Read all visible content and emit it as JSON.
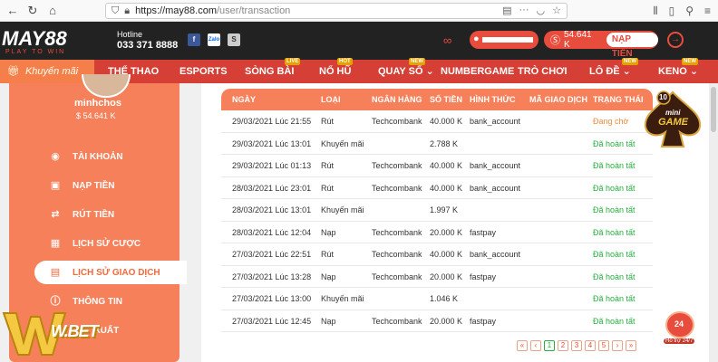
{
  "browser": {
    "url_host": "https://may88.com",
    "url_path": "/user/transaction"
  },
  "header": {
    "logo": "MAY88",
    "logo_sub": "PLAY TO WIN",
    "hotline_label": "Hotline",
    "hotline_number": "033 371 8888",
    "balance": "54.641 K",
    "deposit_label": "NẠP TIỀN"
  },
  "nav": {
    "items": [
      {
        "label": "Khuyến mãi"
      },
      {
        "label": "THỂ THAO"
      },
      {
        "label": "ESPORTS"
      },
      {
        "label": "SÒNG BÀI",
        "badge": "LIVE"
      },
      {
        "label": "NỔ HŨ",
        "badge": "HOT"
      },
      {
        "label": "QUAY SỐ ⌄",
        "badge": "NEW"
      },
      {
        "label": "NUMBERGAME"
      },
      {
        "label": "TRÒ CHƠI"
      },
      {
        "label": "LÔ ĐỀ ⌄",
        "badge": "NEW"
      },
      {
        "label": "KENO ⌄",
        "badge": "NEW"
      }
    ]
  },
  "sidebar": {
    "username": "minhchos",
    "balance": "$ 54.641 K",
    "items": [
      {
        "label": "TÀI KHOẢN",
        "icon": "user-icon"
      },
      {
        "label": "NẠP TIỀN",
        "icon": "deposit-icon"
      },
      {
        "label": "RÚT TIỀN",
        "icon": "withdraw-icon"
      },
      {
        "label": "LỊCH SỬ CƯỢC",
        "icon": "bet-history-icon"
      },
      {
        "label": "LỊCH SỬ GIAO DỊCH",
        "icon": "transaction-icon"
      },
      {
        "label": "THÔNG TIN",
        "icon": "info-icon"
      },
      {
        "label": "XUẤT",
        "icon": "logout-icon"
      }
    ]
  },
  "table": {
    "headers": [
      "NGÀY",
      "LOẠI",
      "NGÂN HÀNG",
      "SỐ TIỀN",
      "HÌNH THỨC",
      "MÃ GIAO DỊCH",
      "TRẠNG THÁI"
    ],
    "rows": [
      [
        "29/03/2021 Lúc 21:55",
        "Rút",
        "Techcombank",
        "40.000 K",
        "bank_account",
        "",
        "Đang chờ"
      ],
      [
        "29/03/2021 Lúc 13:01",
        "Khuyến mãi",
        "",
        "2.788 K",
        "",
        "",
        "Đã hoàn tất"
      ],
      [
        "29/03/2021 Lúc 01:13",
        "Rút",
        "Techcombank",
        "40.000 K",
        "bank_account",
        "",
        "Đã hoàn tất"
      ],
      [
        "28/03/2021 Lúc 23:01",
        "Rút",
        "Techcombank",
        "40.000 K",
        "bank_account",
        "",
        "Đã hoàn tất"
      ],
      [
        "28/03/2021 Lúc 13:01",
        "Khuyến mãi",
        "",
        "1.997 K",
        "",
        "",
        "Đã hoàn tất"
      ],
      [
        "28/03/2021 Lúc 12:04",
        "Nạp",
        "Techcombank",
        "20.000 K",
        "fastpay",
        "",
        "Đã hoàn tất"
      ],
      [
        "27/03/2021 Lúc 22:51",
        "Rút",
        "Techcombank",
        "40.000 K",
        "bank_account",
        "",
        "Đã hoàn tất"
      ],
      [
        "27/03/2021 Lúc 13:28",
        "Nạp",
        "Techcombank",
        "20.000 K",
        "fastpay",
        "",
        "Đã hoàn tất"
      ],
      [
        "27/03/2021 Lúc 13:00",
        "Khuyến mãi",
        "",
        "1.046 K",
        "",
        "",
        "Đã hoàn tất"
      ],
      [
        "27/03/2021 Lúc 12:45",
        "Nạp",
        "Techcombank",
        "20.000 K",
        "fastpay",
        "",
        "Đã hoàn tất"
      ]
    ]
  },
  "pager": {
    "items": [
      "«",
      "‹",
      "1",
      "2",
      "3",
      "4",
      "5",
      "›",
      "»"
    ],
    "current": "1"
  },
  "badges": {
    "mini_game_count": "10",
    "mini_game_line1": "mini",
    "mini_game_line2": "GAME",
    "support_number": "24",
    "support_label": "Hỗ trợ 24/7",
    "watermark": "W.BET"
  },
  "colors": {
    "accent": "#e84c3d",
    "sidebar": "#f6805a",
    "success": "#27ae3f",
    "pending": "#f28a3d"
  }
}
